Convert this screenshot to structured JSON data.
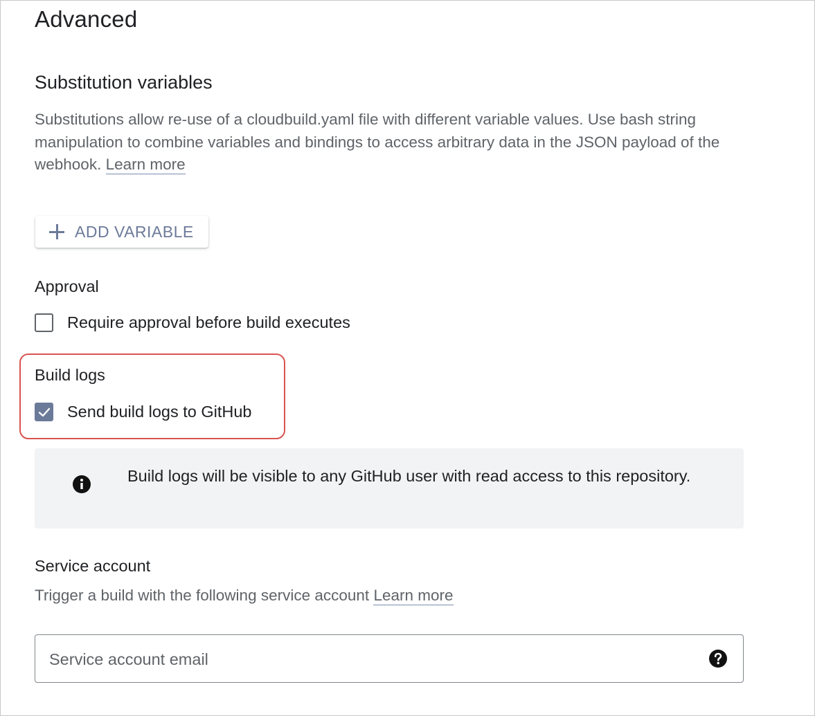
{
  "page": {
    "title": "Advanced"
  },
  "substitution": {
    "title": "Substitution variables",
    "description": "Substitutions allow re-use of a cloudbuild.yaml file with different variable values. Use bash string manipulation to combine variables and bindings to access arbitrary data in the JSON payload of the webhook.",
    "learn_more": "Learn more",
    "add_button_label": "ADD VARIABLE",
    "add_button_icon": "plus-icon"
  },
  "approval": {
    "title": "Approval",
    "checkbox_label": "Require approval before build executes",
    "checked": false
  },
  "build_logs": {
    "title": "Build logs",
    "checkbox_label": "Send build logs to GitHub",
    "checked": true,
    "highlight_color": "#d9534f",
    "info_icon": "info-icon",
    "info_text": "Build logs will be visible to any GitHub user with read access to this repository."
  },
  "service_account": {
    "title": "Service account",
    "description": "Trigger a build with the following service account",
    "learn_more": "Learn more",
    "input_placeholder": "Service account email",
    "input_value": "",
    "help_icon": "help-circle-icon"
  },
  "colors": {
    "accent": "#6c7a99",
    "highlight": "#d9534f",
    "info_background": "#f1f3f4"
  }
}
